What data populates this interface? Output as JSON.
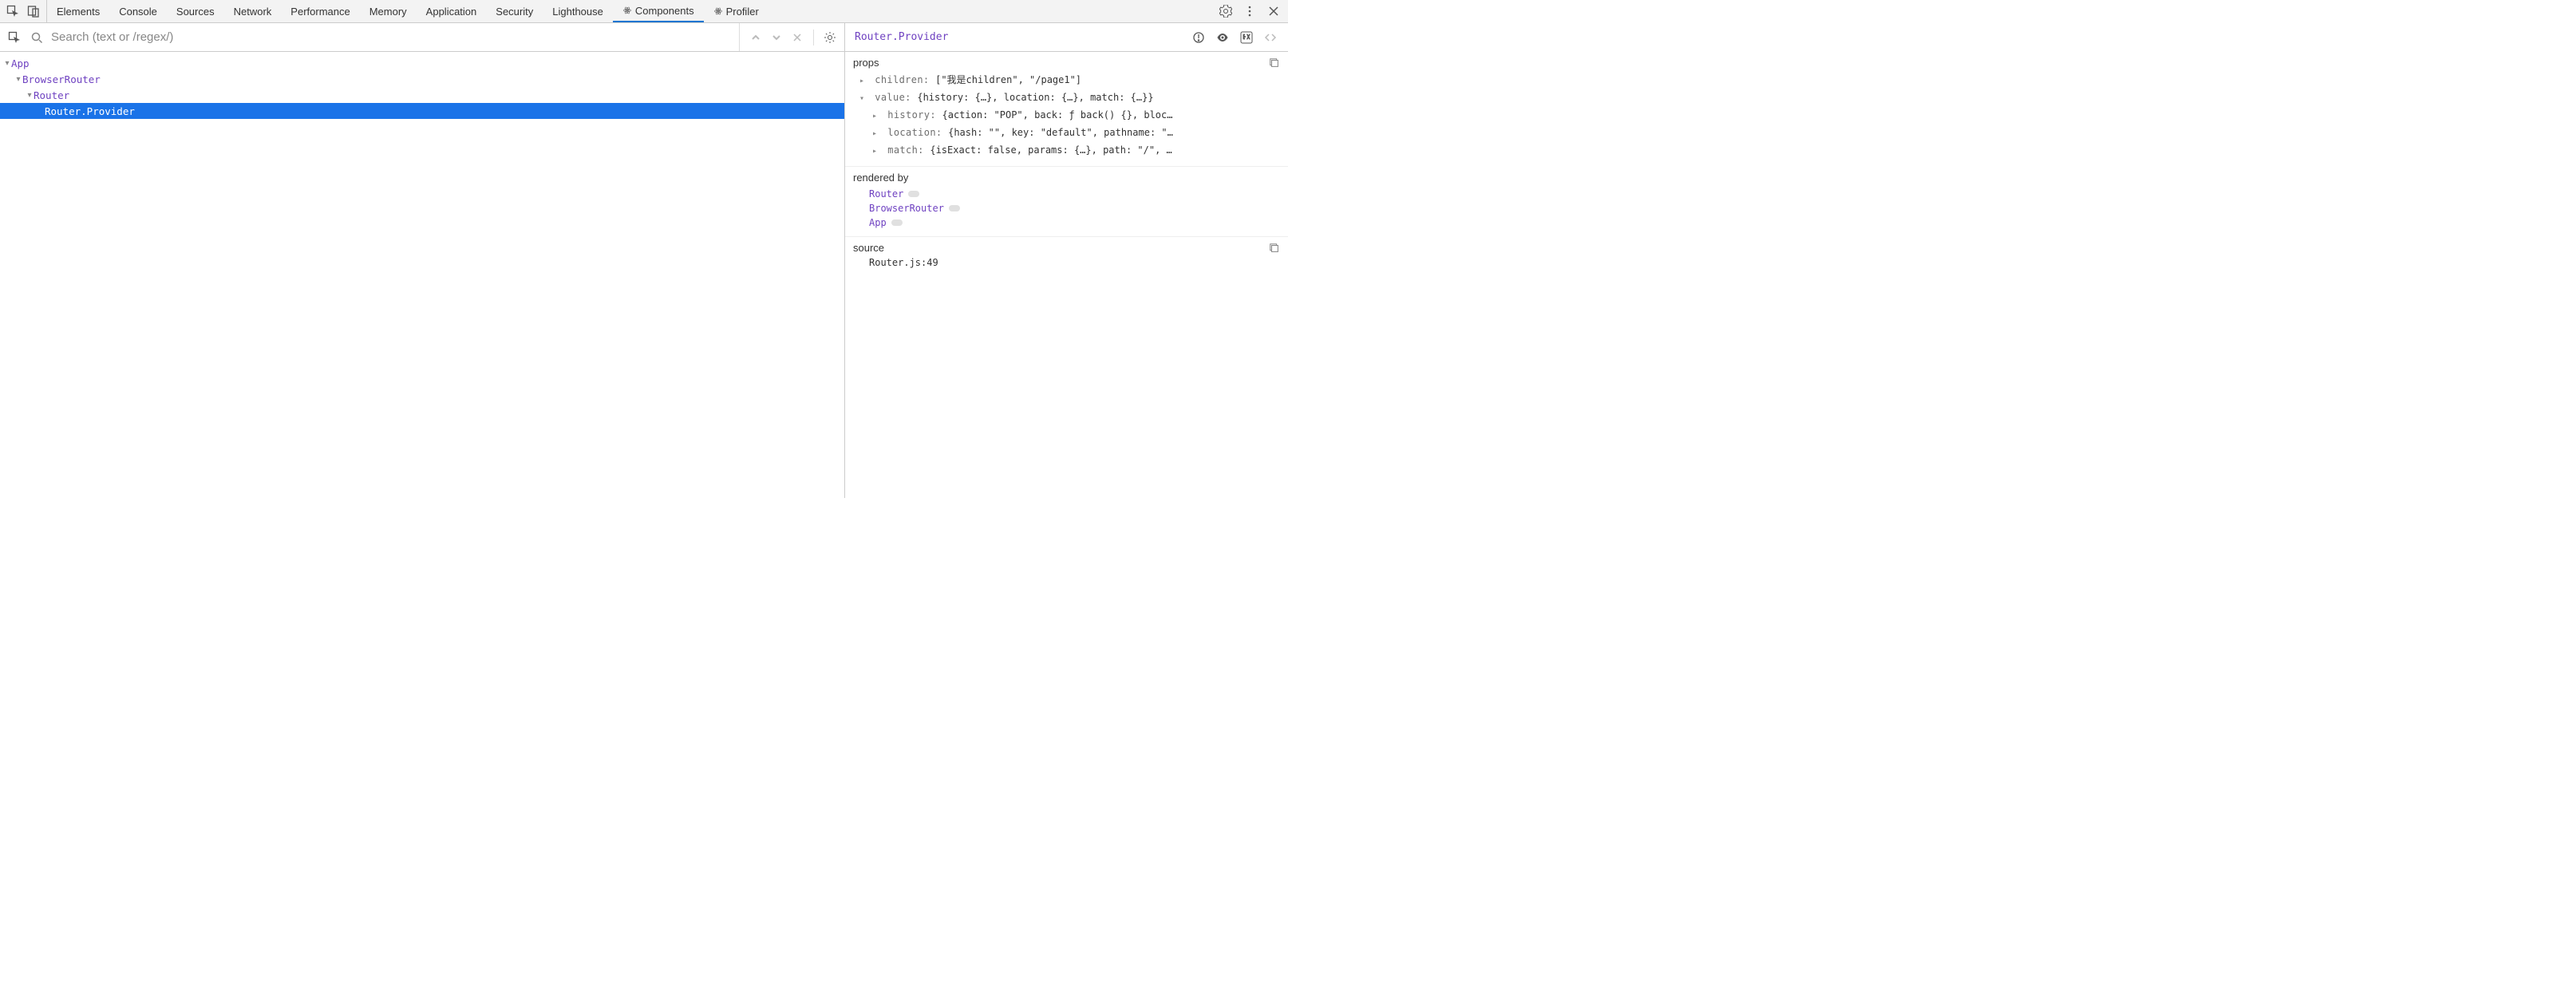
{
  "topbar": {
    "tabs": [
      {
        "label": "Elements",
        "active": false,
        "react": false
      },
      {
        "label": "Console",
        "active": false,
        "react": false
      },
      {
        "label": "Sources",
        "active": false,
        "react": false
      },
      {
        "label": "Network",
        "active": false,
        "react": false
      },
      {
        "label": "Performance",
        "active": false,
        "react": false
      },
      {
        "label": "Memory",
        "active": false,
        "react": false
      },
      {
        "label": "Application",
        "active": false,
        "react": false
      },
      {
        "label": "Security",
        "active": false,
        "react": false
      },
      {
        "label": "Lighthouse",
        "active": false,
        "react": false
      },
      {
        "label": "Components",
        "active": true,
        "react": true
      },
      {
        "label": "Profiler",
        "active": false,
        "react": true
      }
    ]
  },
  "search": {
    "placeholder": "Search (text or /regex/)"
  },
  "tree": {
    "rows": [
      {
        "indent": 0,
        "arrow": "▾",
        "label": "App",
        "selected": false
      },
      {
        "indent": 1,
        "arrow": "▾",
        "label": "BrowserRouter",
        "selected": false
      },
      {
        "indent": 2,
        "arrow": "▾",
        "label": "Router",
        "selected": false
      },
      {
        "indent": 3,
        "arrow": "",
        "label": "Router.Provider",
        "selected": true
      }
    ]
  },
  "detail": {
    "title": "Router.Provider",
    "props_header": "props",
    "props": {
      "children_key": "children",
      "children_val": "[\"我是children\", \"/page1\"]",
      "value_key": "value",
      "value_val": "{history: {…}, location: {…}, match: {…}}",
      "history_key": "history",
      "history_val": "{action: \"POP\", back: ƒ back() {}, bloc…",
      "location_key": "location",
      "location_val": "{hash: \"\", key: \"default\", pathname: \"…",
      "match_key": "match",
      "match_val": "{isExact: false, params: {…}, path: \"/\", …"
    },
    "rendered_by_header": "rendered by",
    "rendered_by": [
      "Router",
      "BrowserRouter",
      "App"
    ],
    "source_header": "source",
    "source": "Router.js:49"
  }
}
